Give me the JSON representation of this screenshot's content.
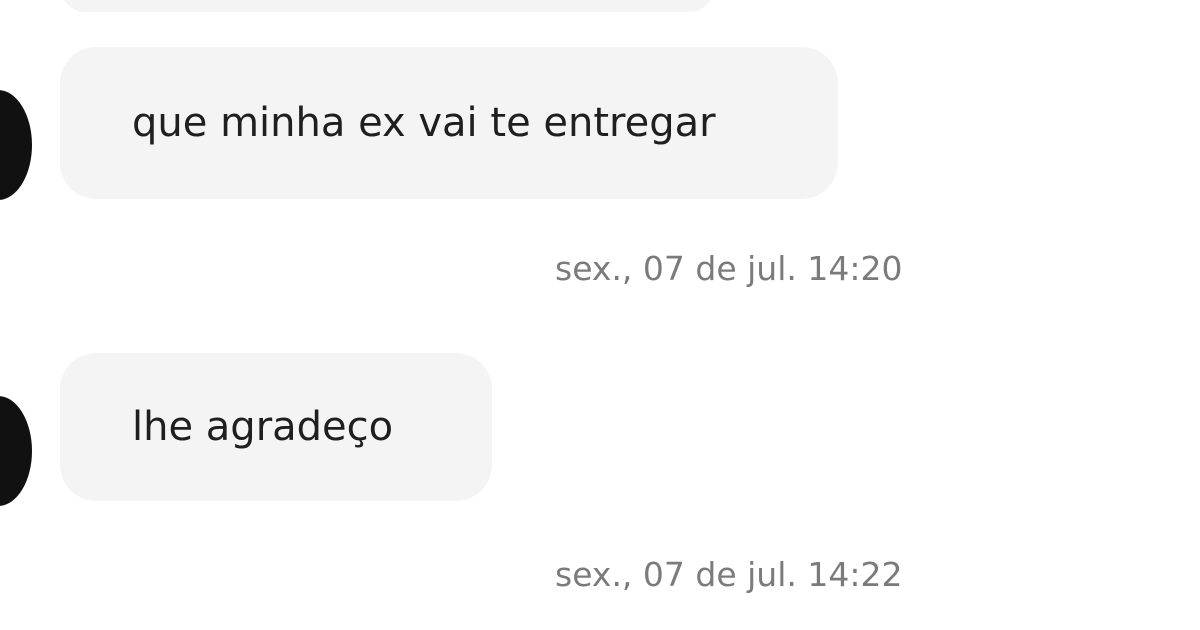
{
  "messages": [
    {
      "text": "que minha ex vai te entregar",
      "time": "sex., 07 de jul. 14:20"
    },
    {
      "text": "lhe agradeço",
      "time": "sex., 07 de jul. 14:22"
    }
  ],
  "colors": {
    "bubble": "#f4f4f4",
    "avatar": "#111111",
    "text": "#1f1f1f",
    "timestamp": "#7b7b7b",
    "background": "#ffffff"
  }
}
